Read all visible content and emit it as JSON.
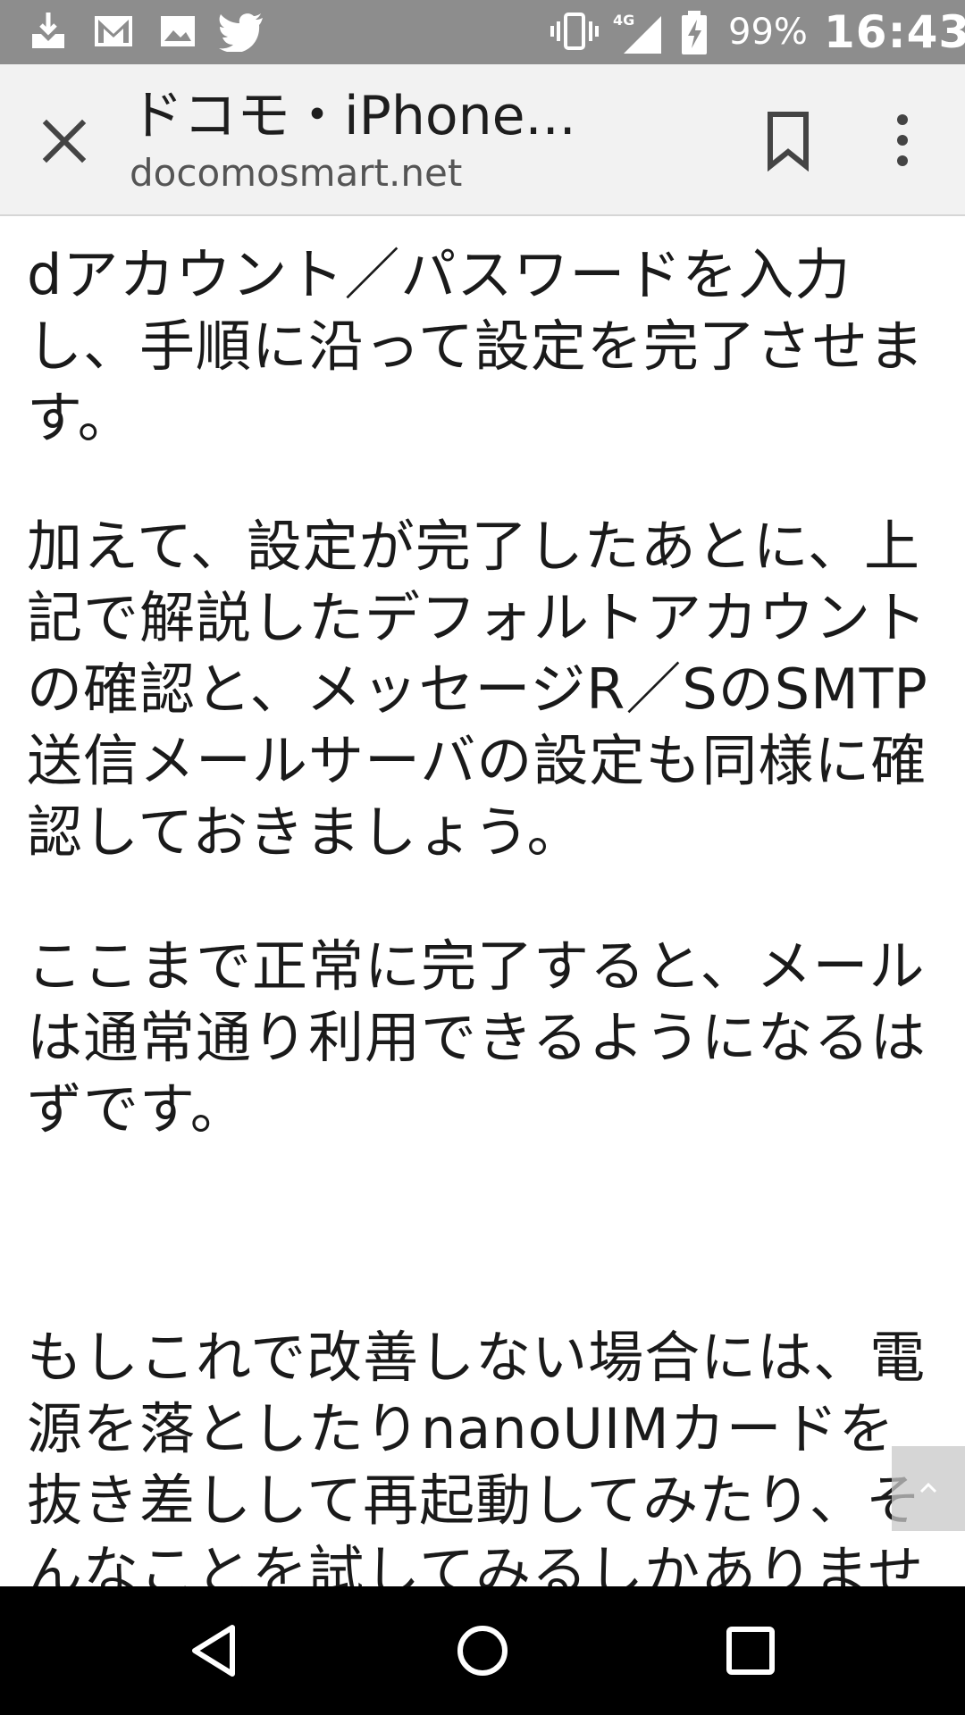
{
  "status_bar": {
    "notification_icons": [
      "downloader-icon",
      "gmail-icon",
      "image-icon",
      "twitter-icon"
    ],
    "system_icons": [
      "vibrate-icon",
      "signal-4g-icon",
      "battery-charging-icon"
    ],
    "network_label": "4G",
    "battery_percent": "99%",
    "time": "16:43"
  },
  "toolbar": {
    "title": "ドコモ・iPhone...",
    "url": "docomosmart.net"
  },
  "content": {
    "paragraphs": [
      "dアカウント／パスワードを入力し、手順に沿って設定を完了させます。",
      "加えて、設定が完了したあとに、上記で解説したデフォルトアカウントの確認と、メッセージR／SのSMTP送信メールサーバの設定も同様に確認しておきましょう。",
      "ここまで正常に完了すると、メールは通常通り利用できるようになるはずです。",
      "もしこれで改善しない場合には、電源を落としたりnanoUIMカードを抜き差しして再起動してみたり、そんなことを試してみるしかありません"
    ]
  },
  "colors": {
    "status_bar": "#8d8d8d",
    "toolbar": "#f2f2f2",
    "text": "#1a1a1a",
    "nav_bar": "#000000"
  }
}
